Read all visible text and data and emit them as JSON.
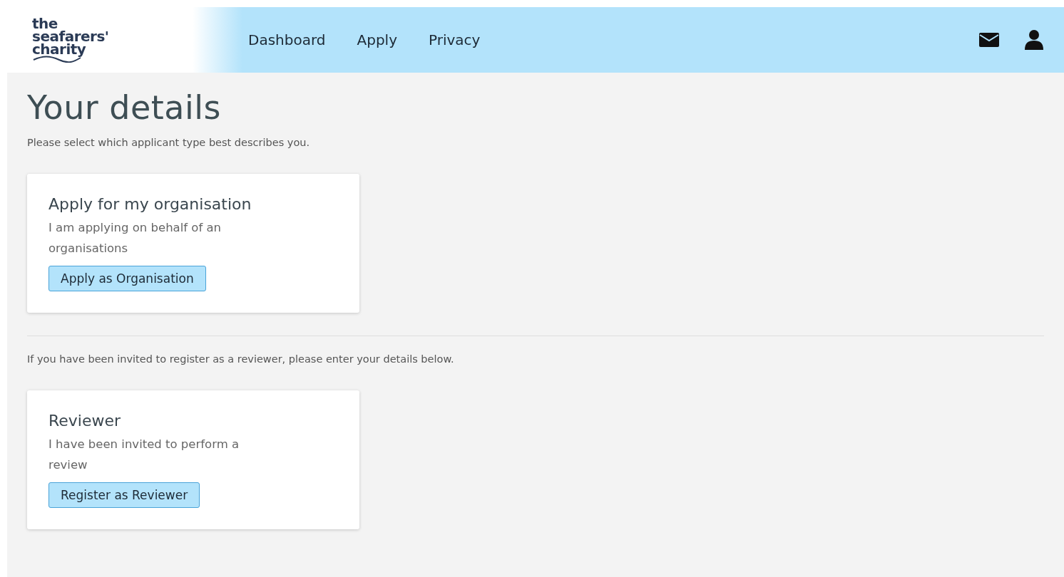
{
  "logo": {
    "lines": [
      "the",
      "seafarers'",
      "charity"
    ]
  },
  "nav": [
    {
      "label": "Dashboard"
    },
    {
      "label": "Apply"
    },
    {
      "label": "Privacy"
    }
  ],
  "page": {
    "title": "Your details",
    "intro": "Please select which applicant type best describes you.",
    "reviewer_intro": "If you have been invited to register as a reviewer, please enter your details below."
  },
  "cards": [
    {
      "title": "Apply for my organisation",
      "text": "I am applying on behalf of an organisations",
      "button": "Apply as Organisation"
    },
    {
      "title": "Reviewer",
      "text": "I have been invited to perform a review",
      "button": "Register as Reviewer"
    }
  ]
}
